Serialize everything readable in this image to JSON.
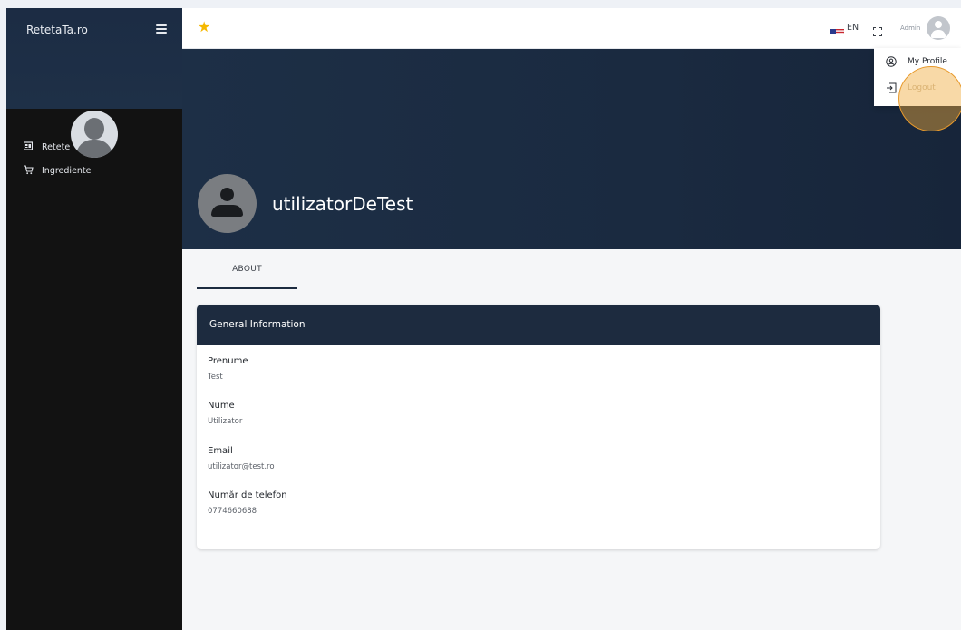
{
  "sidebar": {
    "brand": "RetetaTa.ro",
    "items": [
      {
        "label": "Retete",
        "icon": "recipes-icon"
      },
      {
        "label": "Ingrediente",
        "icon": "cart-icon"
      }
    ]
  },
  "topbar": {
    "language": "EN",
    "user_name": "Admin"
  },
  "profile": {
    "username": "utilizatorDeTest"
  },
  "tabs": [
    {
      "label": "ABOUT",
      "active": true
    }
  ],
  "general_info": {
    "title": "General Information",
    "fields": [
      {
        "label": "Prenume",
        "value": "Test"
      },
      {
        "label": "Nume",
        "value": "Utilizator"
      },
      {
        "label": "Email",
        "value": "utilizator@test.ro"
      },
      {
        "label": "Număr de telefon",
        "value": "0774660688"
      }
    ]
  },
  "user_menu": {
    "items": [
      {
        "label": "My Profile",
        "icon": "user-circle-icon"
      },
      {
        "label": "Logout",
        "icon": "logout-icon"
      }
    ]
  },
  "colors": {
    "sidebar_bg": "#121212",
    "header_navy": "#1d2b3f",
    "accent_star": "#f5b800",
    "cursor_highlight": "#e89a2c"
  }
}
